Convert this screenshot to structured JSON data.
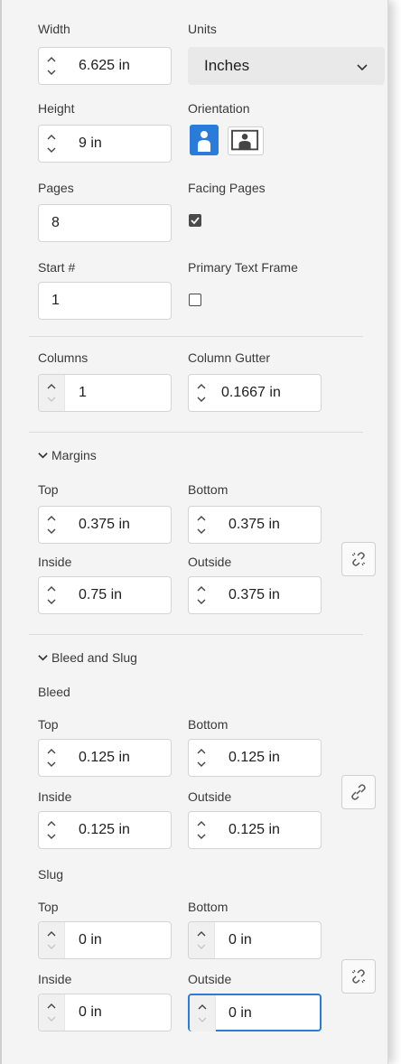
{
  "size": {
    "width_label": "Width",
    "width_value": "6.625 in",
    "units_label": "Units",
    "units_value": "Inches",
    "height_label": "Height",
    "height_value": "9 in",
    "orientation_label": "Orientation"
  },
  "pages": {
    "pages_label": "Pages",
    "pages_value": "8",
    "facing_label": "Facing Pages",
    "facing_checked": true,
    "start_label": "Start #",
    "start_value": "1",
    "primary_label": "Primary Text Frame",
    "primary_checked": false
  },
  "columns": {
    "columns_label": "Columns",
    "columns_value": "1",
    "gutter_label": "Column Gutter",
    "gutter_value": "0.1667 in"
  },
  "margins": {
    "header": "Margins",
    "top_label": "Top",
    "top_value": "0.375 in",
    "bottom_label": "Bottom",
    "bottom_value": "0.375 in",
    "inside_label": "Inside",
    "inside_value": "0.75 in",
    "outside_label": "Outside",
    "outside_value": "0.375 in"
  },
  "bleed_slug": {
    "header": "Bleed and Slug",
    "bleed_label": "Bleed",
    "bleed": {
      "top_label": "Top",
      "top_value": "0.125 in",
      "bottom_label": "Bottom",
      "bottom_value": "0.125 in",
      "inside_label": "Inside",
      "inside_value": "0.125 in",
      "outside_label": "Outside",
      "outside_value": "0.125 in"
    },
    "slug_label": "Slug",
    "slug": {
      "top_label": "Top",
      "top_value": "0 in",
      "bottom_label": "Bottom",
      "bottom_value": "0 in",
      "inside_label": "Inside",
      "inside_value": "0 in",
      "outside_label": "Outside",
      "outside_value": "0 in"
    }
  },
  "colors": {
    "accent": "#2b7bdb",
    "panel_bg": "#f4f4f4"
  },
  "icons": [
    "stepper-icon",
    "chevron-down-icon",
    "portrait-icon",
    "landscape-icon",
    "broken-link-icon",
    "link-icon",
    "checkbox-icon"
  ]
}
